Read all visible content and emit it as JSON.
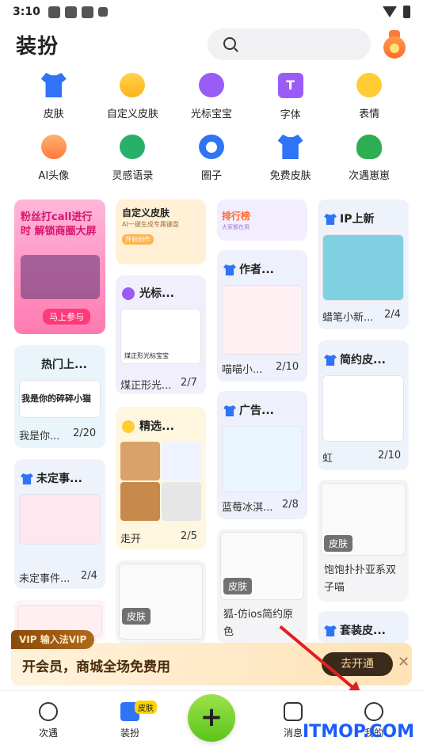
{
  "status_bar": {
    "time": "3:10"
  },
  "header": {
    "title": "装扮",
    "search": {
      "placeholder": ""
    }
  },
  "categories": [
    {
      "label": "皮肤",
      "icon": "tshirt-icon"
    },
    {
      "label": "自定义皮肤",
      "icon": "palette-icon"
    },
    {
      "label": "光标宝宝",
      "icon": "cursor-pet-icon"
    },
    {
      "label": "字体",
      "icon": "font-icon"
    },
    {
      "label": "表情",
      "icon": "emoji-icon"
    },
    {
      "label": "AI头像",
      "icon": "ai-avatar-icon"
    },
    {
      "label": "灵感语录",
      "icon": "quote-icon"
    },
    {
      "label": "圈子",
      "icon": "circle-icon"
    },
    {
      "label": "免费皮肤",
      "icon": "free-skin-icon"
    },
    {
      "label": "次遇崽崽",
      "icon": "mascot-icon"
    }
  ],
  "feed": {
    "col1": [
      {
        "banner": "粉丝打call进行时 解锁商圈大屏",
        "cta": "马上参与"
      },
      {
        "title": "热门上...",
        "preview": "我是你的碎碎小猫",
        "caption": "我是你...",
        "count": "2/20"
      },
      {
        "title": "未定事...",
        "caption": "未定事件...",
        "count": "2/4"
      }
    ],
    "col2": [
      {
        "title": "自定义皮肤",
        "sub": "AI一键生成专属键盘",
        "cta": "开始创作"
      },
      {
        "title": "光标...",
        "preview": "煤正形光标宝宝",
        "caption": "煤正形光...",
        "count": "2/7"
      },
      {
        "title": "精选...",
        "caption": "走开",
        "count": "2/5"
      },
      {
        "tag": "皮肤"
      }
    ],
    "col3": [
      {
        "title": "排行榜",
        "sub": "大家都在用"
      },
      {
        "title": "作者...",
        "caption": "喵喵小...",
        "count": "2/10"
      },
      {
        "title": "广告...",
        "caption": "蓝莓冰淇...",
        "count": "2/8"
      },
      {
        "tag": "皮肤",
        "caption": "狐-仿ios简约原色"
      }
    ],
    "col4": [
      {
        "title": "IP上新",
        "caption": "蜡笔小新...",
        "count": "2/4"
      },
      {
        "title": "简约皮...",
        "caption": "虹",
        "count": "2/10"
      },
      {
        "tag": "皮肤",
        "caption": "饱饱扑扑亚系双子喵"
      },
      {
        "title": "套装皮..."
      }
    ]
  },
  "vip": {
    "tag": "VIP 输入法VIP",
    "message": "开会员，商城全场免费用",
    "button": "去开通",
    "close": "✕"
  },
  "bottom_nav": [
    {
      "label": "次遇",
      "icon": "mascot-face-icon"
    },
    {
      "label": "装扮",
      "icon": "tshirt-icon",
      "badge": "皮肤"
    },
    {
      "label": "+",
      "icon": "plus-icon"
    },
    {
      "label": "消息",
      "icon": "message-icon"
    },
    {
      "label": "我的",
      "icon": "profile-icon"
    }
  ],
  "watermark": "ITMOP.COM",
  "colors": {
    "accent_blue": "#2f74f6",
    "accent_green": "#5cc41c",
    "vip_gold": "#ffe2b6",
    "annotation_red": "#e02020"
  }
}
